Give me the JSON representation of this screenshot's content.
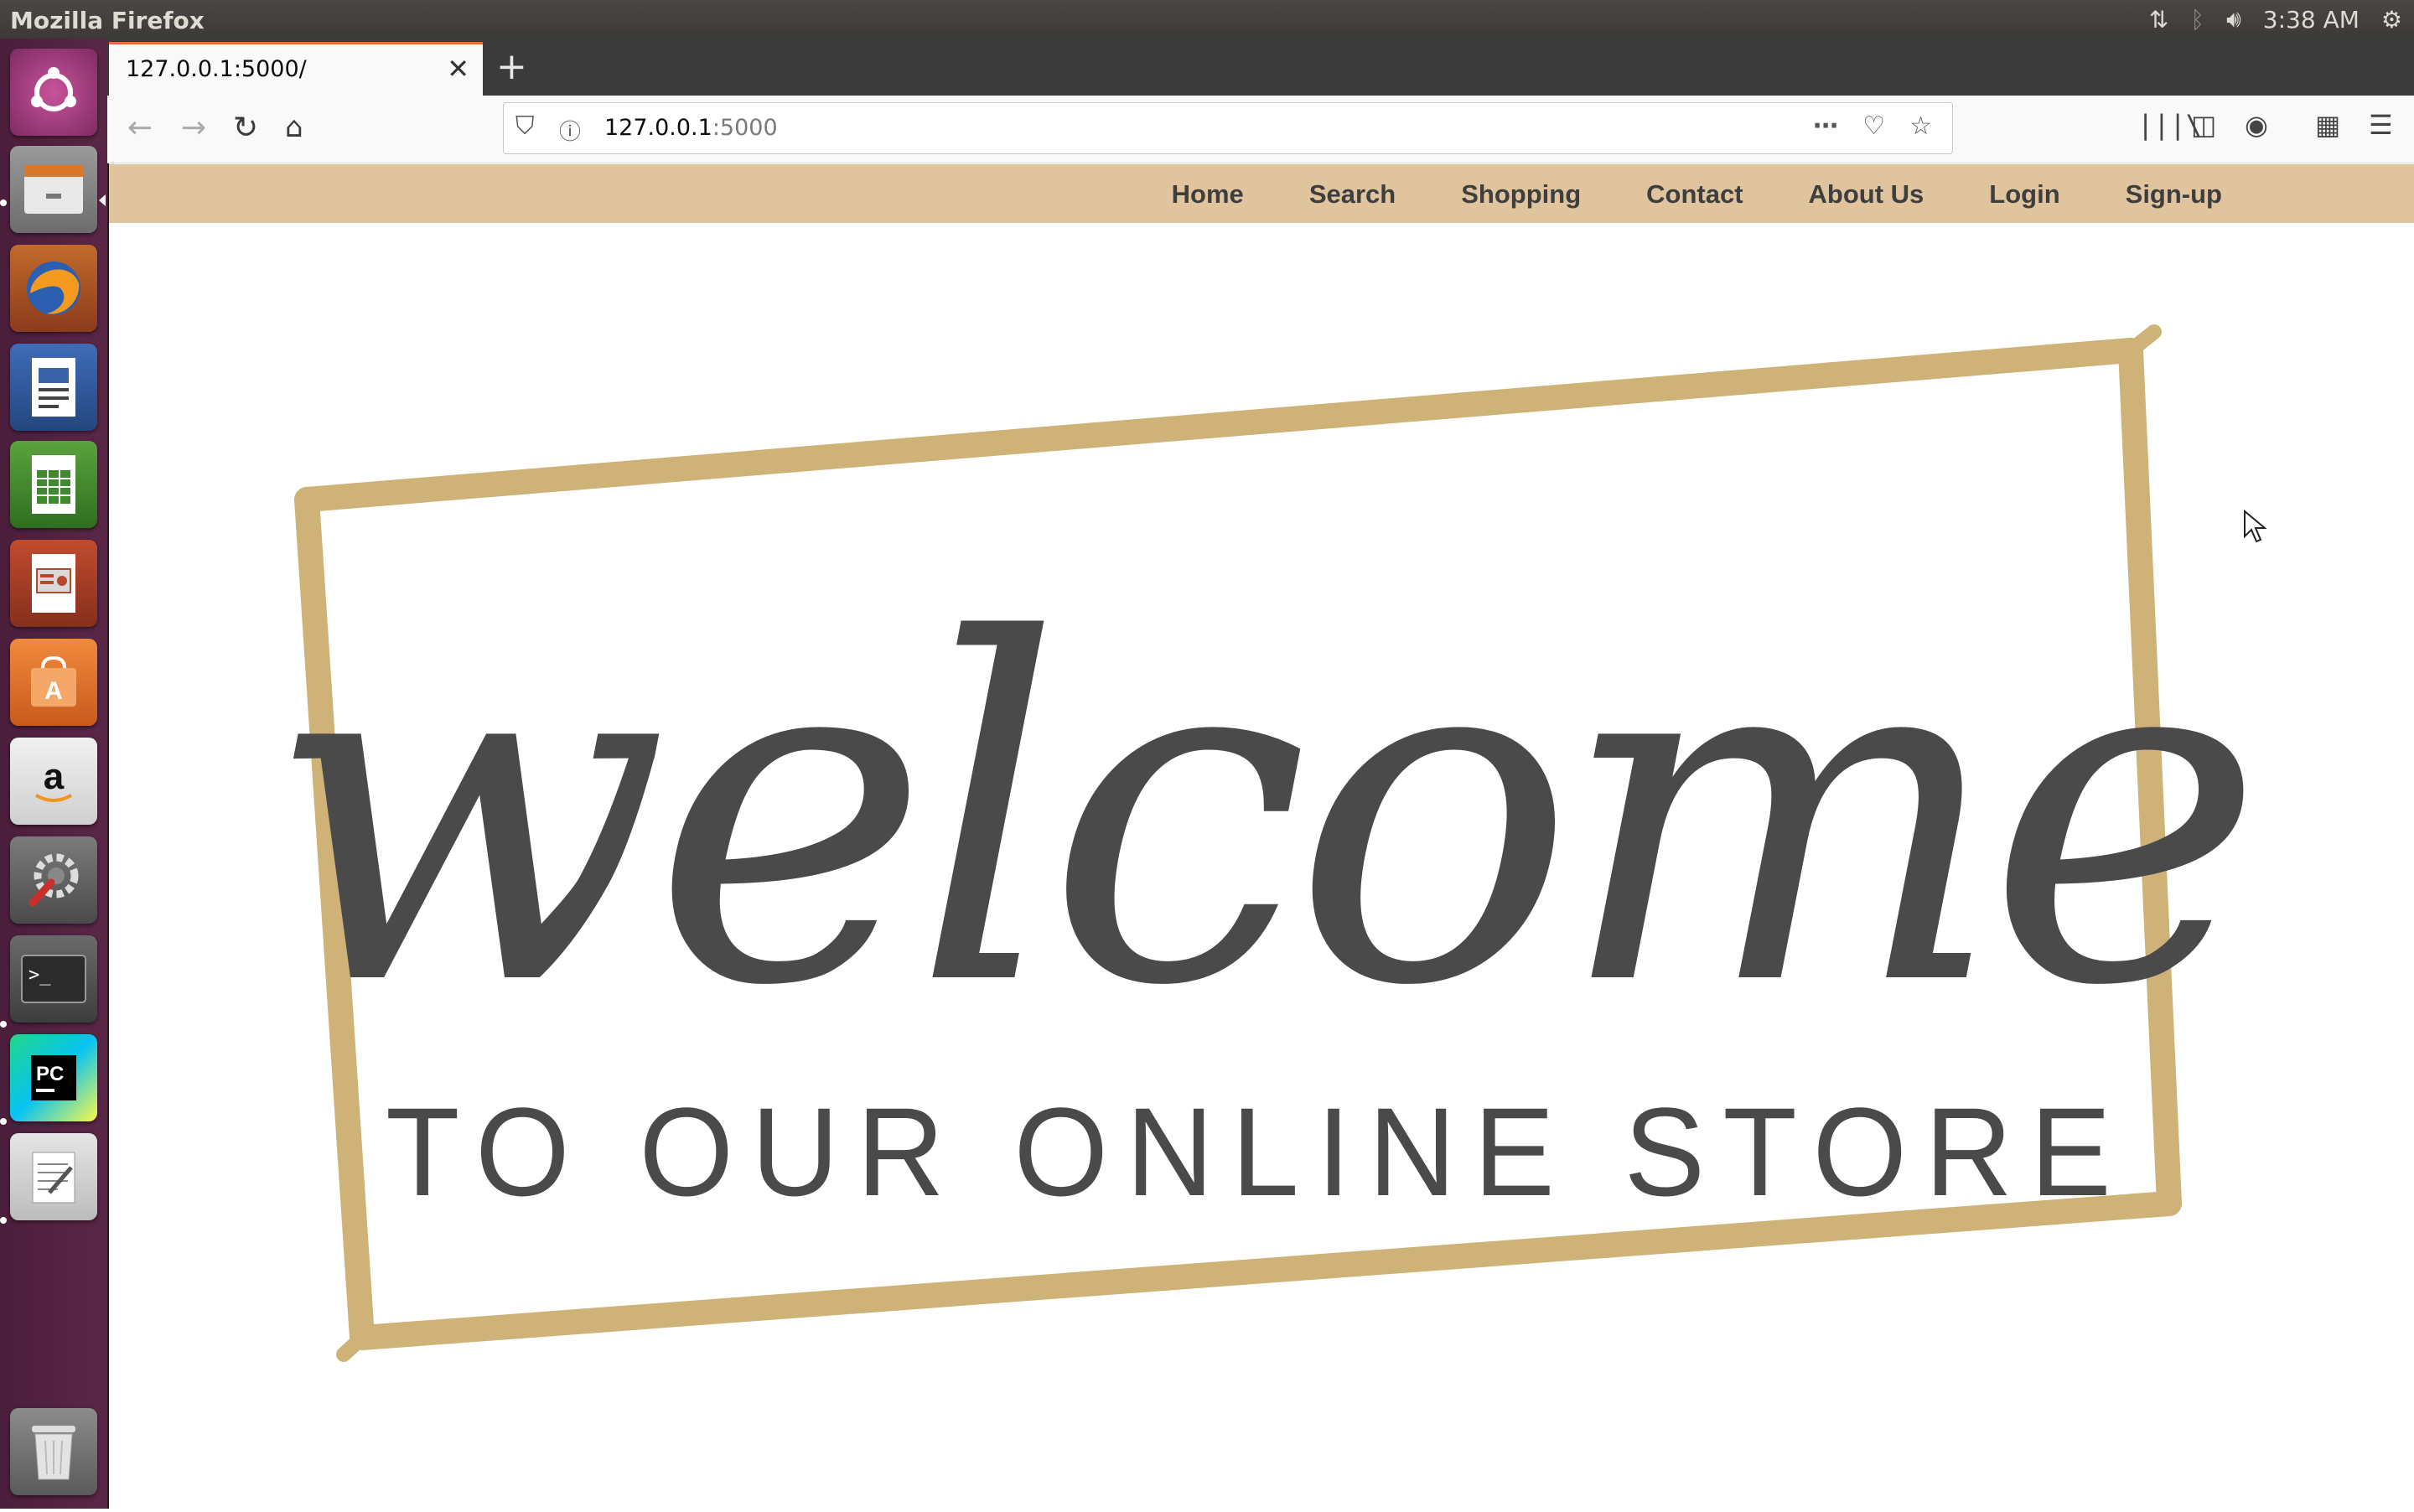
{
  "system": {
    "app_title": "Mozilla Firefox",
    "clock": "3:38 AM"
  },
  "launcher": {
    "items": [
      {
        "name": "ubuntu-dash-icon"
      },
      {
        "name": "files-icon"
      },
      {
        "name": "firefox-icon"
      },
      {
        "name": "writer-icon"
      },
      {
        "name": "calc-icon"
      },
      {
        "name": "impress-icon"
      },
      {
        "name": "software-center-icon"
      },
      {
        "name": "amazon-icon"
      },
      {
        "name": "system-settings-icon"
      },
      {
        "name": "terminal-icon"
      },
      {
        "name": "pycharm-icon"
      },
      {
        "name": "text-editor-icon"
      },
      {
        "name": "trash-icon"
      }
    ]
  },
  "browser": {
    "tab_title": "127.0.0.1:5000/",
    "url_host": "127.0.0.1",
    "url_port": ":5000"
  },
  "site": {
    "nav": [
      "Home",
      "Search",
      "Shopping",
      "Contact",
      "About Us",
      "Login",
      "Sign-up"
    ],
    "hero_script": "welcome",
    "hero_tagline": "TO OUR ONLINE STORE",
    "frame_color": "#cfb277",
    "text_color": "#4a4a4a"
  }
}
